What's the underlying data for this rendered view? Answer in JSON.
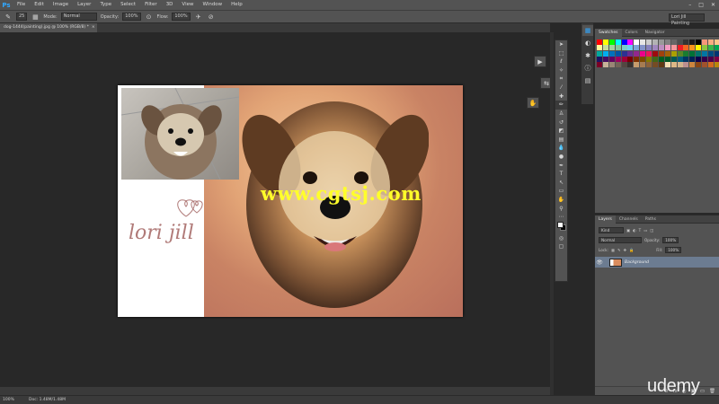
{
  "app": {
    "logo": "Ps"
  },
  "menu": [
    "File",
    "Edit",
    "Image",
    "Layer",
    "Type",
    "Select",
    "Filter",
    "3D",
    "View",
    "Window",
    "Help"
  ],
  "window_controls": [
    "–",
    "□",
    "✕"
  ],
  "options_bar": {
    "brush_size": "25",
    "mode_label": "Mode:",
    "mode_value": "Normal",
    "opacity_label": "Opacity:",
    "opacity_value": "100%",
    "flow_label": "Flow:",
    "flow_value": "100%"
  },
  "workspace": "Lori Jill Painting",
  "document_tab": {
    "title": "dog-1444(painting).jpg @ 100% (RGB/8) *",
    "close": "×"
  },
  "document": {
    "logo_text": "lori jill"
  },
  "watermark": "www.cgtsj.com",
  "swatches_panel": {
    "tabs": [
      "Swatches",
      "Colors",
      "Navigator"
    ],
    "active_tab": 0
  },
  "swatch_colors": [
    "#ff0000",
    "#ffff00",
    "#00ff00",
    "#00ffff",
    "#0000ff",
    "#ff00ff",
    "#ffffff",
    "#e6e6e6",
    "#cccccc",
    "#b3b3b3",
    "#999999",
    "#808080",
    "#666666",
    "#4d4d4d",
    "#333333",
    "#1a1a1a",
    "#000000",
    "#f7977a",
    "#f9ad81",
    "#fdc68a",
    "#fff79a",
    "#c4df9b",
    "#a2d39c",
    "#82ca9d",
    "#7bcdc8",
    "#6ecff6",
    "#7ea7d8",
    "#8493ca",
    "#8882be",
    "#a187be",
    "#bc8dbf",
    "#f49ac2",
    "#f6989d",
    "#ed1c24",
    "#f26522",
    "#f7941d",
    "#fff200",
    "#8dc63f",
    "#39b54a",
    "#00a651",
    "#00a99d",
    "#00aeef",
    "#0072bc",
    "#0054a6",
    "#2e3192",
    "#662d91",
    "#92278f",
    "#ec008c",
    "#ed145b",
    "#9e0b0f",
    "#a0410d",
    "#a36209",
    "#aba000",
    "#598527",
    "#1a7b30",
    "#007236",
    "#00746b",
    "#0076a3",
    "#004b80",
    "#003471",
    "#1b1464",
    "#440e62",
    "#630460",
    "#9e005d",
    "#9e0039",
    "#790000",
    "#7b2e00",
    "#7d4900",
    "#827b00",
    "#406618",
    "#005e20",
    "#005826",
    "#005952",
    "#005b7f",
    "#003663",
    "#002157",
    "#0d004c",
    "#32004b",
    "#4b0049",
    "#7b0046",
    "#7a0026",
    "#c7b299",
    "#998675",
    "#736357",
    "#534741",
    "#37302d",
    "#c69c6d",
    "#a67c52",
    "#8c6239",
    "#754c24",
    "#603913",
    "#f5deb3",
    "#deb887",
    "#d2b48c",
    "#bc8f8f",
    "#cd853f",
    "#8b4513",
    "#a0522d",
    "#d2691e",
    "#b8860b"
  ],
  "layers_panel": {
    "tabs": [
      "Layers",
      "Channels",
      "Paths"
    ],
    "active_tab": 0,
    "kind_label": "Kind",
    "blend_mode": "Normal",
    "opacity_label": "Opacity:",
    "opacity_value": "100%",
    "lock_label": "Lock:",
    "fill_label": "Fill:",
    "fill_value": "100%",
    "layers": [
      {
        "name": "Background",
        "visible_icon": "👁"
      }
    ],
    "footer_icons": [
      "⊘",
      "fx",
      "◐",
      "▣",
      "▭",
      "🗑"
    ]
  },
  "status_bar": {
    "zoom": "100%",
    "doc_size": "Doc: 1.48M/1.48M"
  },
  "udemy_logo": "udemy"
}
